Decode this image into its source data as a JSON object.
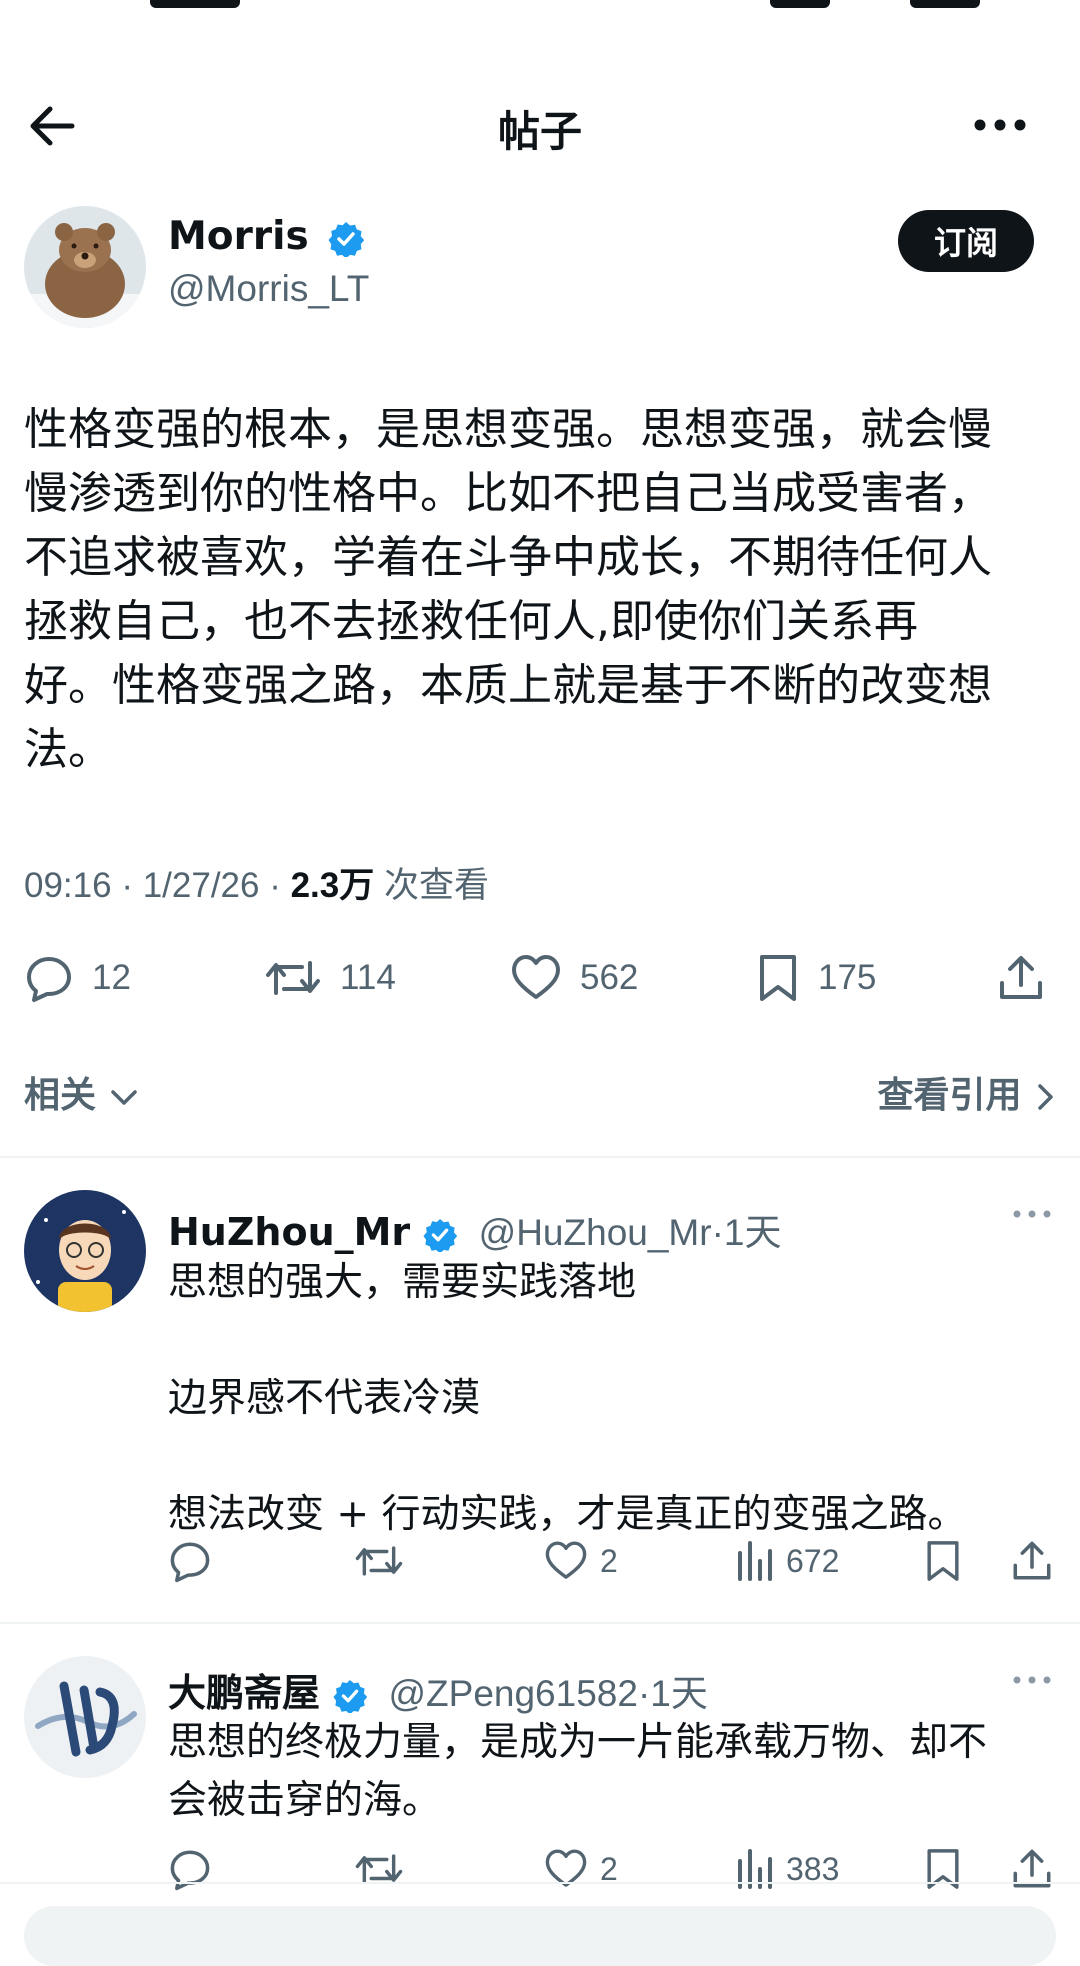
{
  "header": {
    "title": "帖子",
    "back_icon": "arrow-left-icon",
    "more_icon": "more-horizontal-icon"
  },
  "author": {
    "name": "Morris",
    "handle": "@Morris_LT",
    "verified": true,
    "avatar": "bear-avatar",
    "subscribe_label": "订阅"
  },
  "post": {
    "text": "性格变强的根本，是思想变强。思想变强，就会慢\n慢渗透到你的性格中。比如不把自己当成受害者，\n不追求被喜欢，学着在斗争中成长，不期待任何人\n拯救自己，也不去拯救任何人,即使你们关系再\n好。性格变强之路，本质上就是基于不断的改变想\n法。",
    "time": "09:16",
    "date": "1/27/26",
    "views": "2.3万",
    "views_label": "次查看",
    "replies": "12",
    "reposts": "114",
    "likes": "562",
    "bookmarks": "175"
  },
  "related": {
    "label": "相关",
    "view_quotes": "查看引用"
  },
  "replies": [
    {
      "name": "HuZhou_Mr",
      "handle": "@HuZhou_Mr",
      "age": "1天",
      "text": "思想的强大，需要实践落地\n\n边界感不代表冷漠\n\n想法改变 + 行动实践，才是真正的变强之路。",
      "likes": "2",
      "views": "672"
    },
    {
      "name": "大鹏斋屋",
      "handle": "@ZPeng61582",
      "age": "1天",
      "text": "思想的终极力量，是成为一片能承载万物、却不\n会被击穿的海。",
      "likes": "2",
      "views": "383"
    }
  ],
  "colors": {
    "text": "#0f1419",
    "secondary": "#536471",
    "verified": "#1d9bf0",
    "divider": "#eff3f4"
  }
}
